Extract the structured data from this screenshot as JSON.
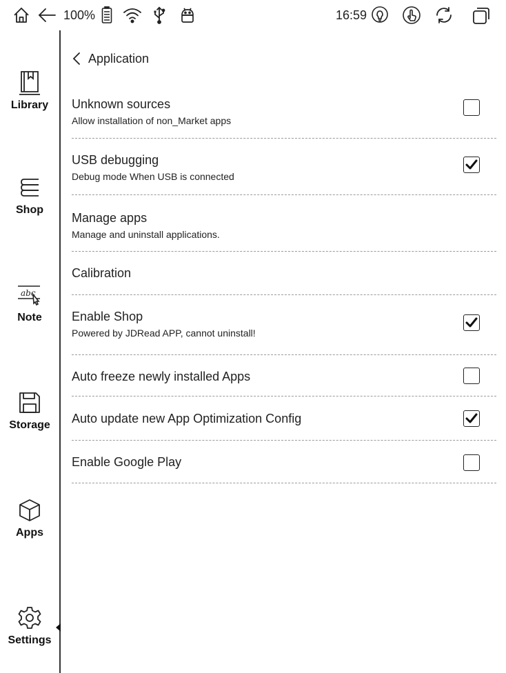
{
  "status_bar": {
    "battery": "100%",
    "time": "16:59"
  },
  "sidebar": {
    "items": [
      {
        "label": "Library",
        "icon": "library-icon"
      },
      {
        "label": "Shop",
        "icon": "shop-icon"
      },
      {
        "label": "Note",
        "icon": "note-icon"
      },
      {
        "label": "Storage",
        "icon": "storage-icon"
      },
      {
        "label": "Apps",
        "icon": "apps-icon"
      },
      {
        "label": "Settings",
        "icon": "settings-icon",
        "active": true
      }
    ]
  },
  "header": {
    "title": "Application"
  },
  "settings": [
    {
      "title": "Unknown sources",
      "subtitle": "Allow installation of non_Market apps",
      "checked": false
    },
    {
      "title": "USB debugging",
      "subtitle": "Debug mode When USB is connected",
      "checked": true
    },
    {
      "title": "Manage apps",
      "subtitle": "Manage and uninstall applications."
    },
    {
      "title": "Calibration"
    },
    {
      "title": "Enable Shop",
      "subtitle": "Powered by JDRead APP, cannot uninstall!",
      "checked": true
    },
    {
      "title": "Auto freeze newly installed Apps",
      "checked": false
    },
    {
      "title": "Auto update new App Optimization Config",
      "checked": true
    },
    {
      "title": "Enable Google Play",
      "checked": false
    }
  ]
}
